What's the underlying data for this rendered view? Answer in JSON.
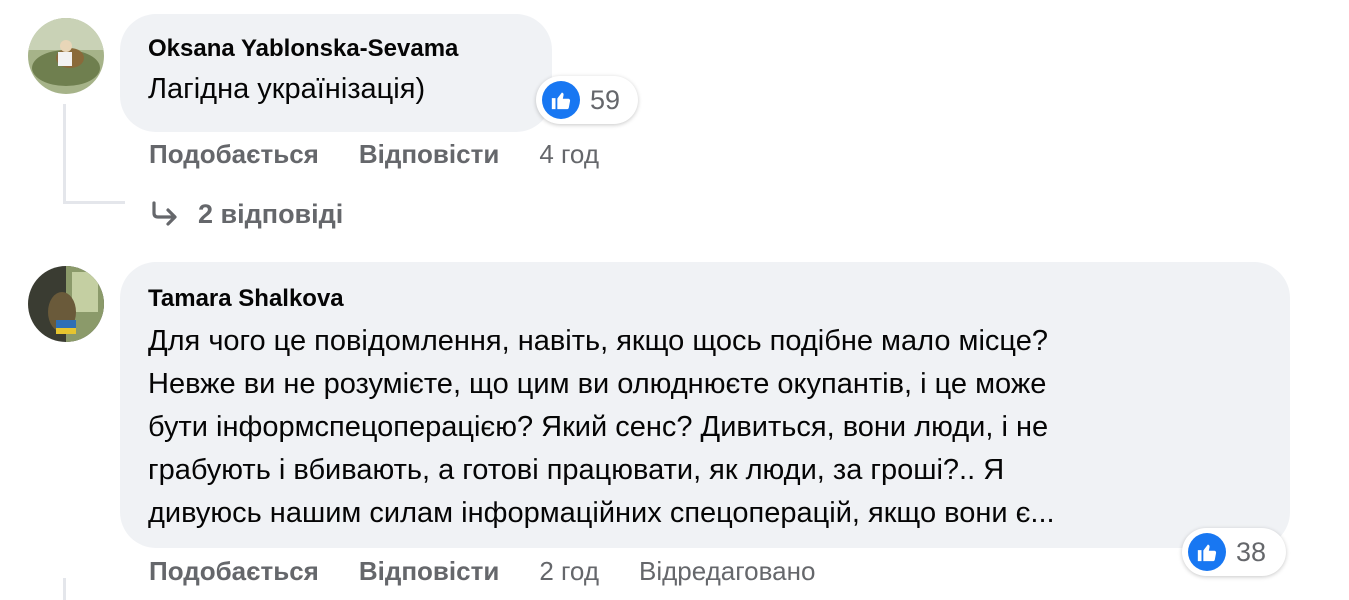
{
  "comments": [
    {
      "author": "Oksana Yablonska-Sevama",
      "text": "Лагідна українізація)",
      "reaction_icon": "like-icon",
      "reaction_count": "59",
      "like_label": "Подобається",
      "reply_label": "Відповісти",
      "time": "4 год",
      "replies_link": "2 відповіді"
    },
    {
      "author": "Tamara Shalkova",
      "text_lines": [
        "Для чого це повідомлення, навіть, якщо щось подібне мало місце?",
        "Невже ви не розумієте, що цим ви олюднюєте окупантів, і це може",
        "бути інформспецоперацією? Який сенс? Дивиться, вони люди, і не",
        "грабують і вбивають, а готові працювати, як люди, за гроші?.. Я",
        "дивуюсь нашим силам інформаційних спецоперацій, якщо вони є..."
      ],
      "reaction_icon": "like-icon",
      "reaction_count": "38",
      "like_label": "Подобається",
      "reply_label": "Відповісти",
      "time": "2 год",
      "edited_label": "Відредаговано"
    }
  ],
  "colors": {
    "bubble": "#f0f2f5",
    "secondary_text": "#65676b",
    "like_blue": "#1877f2",
    "thread_line": "#e4e6eb"
  }
}
